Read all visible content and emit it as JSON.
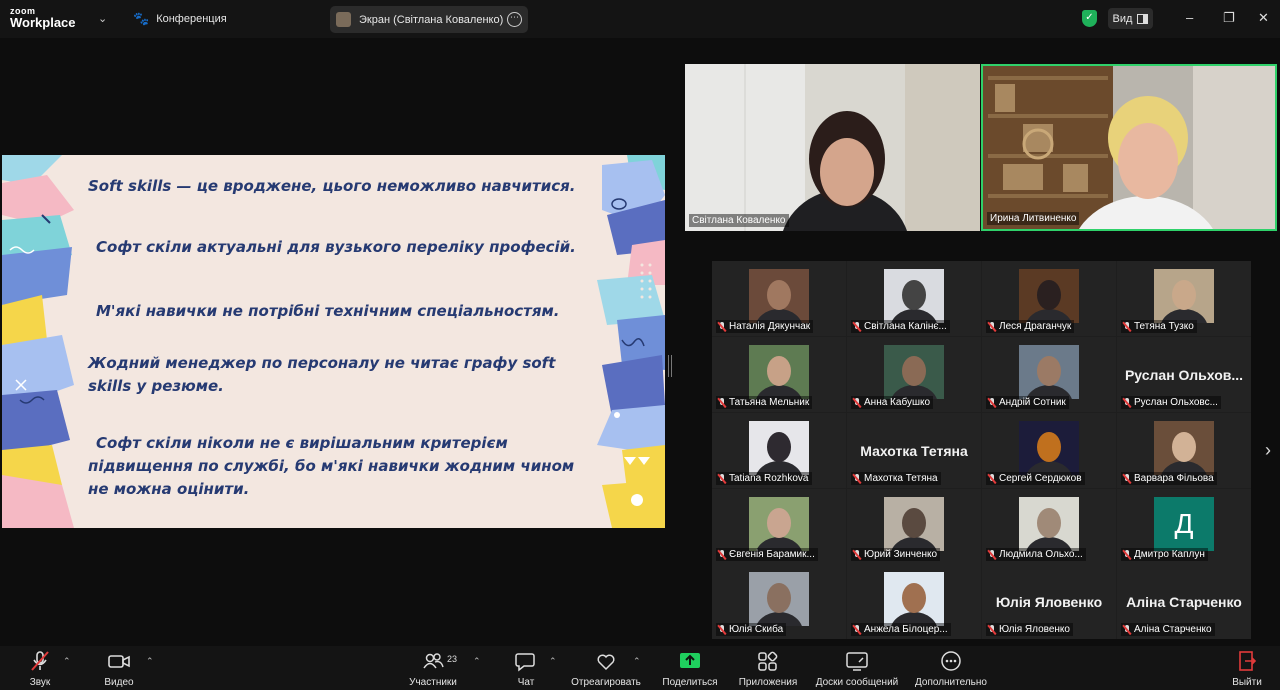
{
  "topbar": {
    "logo_line1": "zoom",
    "logo_line2": "Workplace",
    "meeting": "Конференция",
    "screen_share": "Экран (Світлана Коваленко)",
    "view_label": "Вид",
    "more_glyph": "⋯",
    "minimize": "–",
    "maximize": "❐",
    "close": "✕"
  },
  "slide": {
    "lines": [
      "Soft skills — це вроджене, цього неможливо навчитися.",
      "Софт скіли актуальні для вузького переліку професій.",
      "М'які навички не потрібні технічним  спеціальностям.",
      "Жодний менеджер по персоналу не читає графу soft",
      "skills у резюме.",
      "Софт  скіли  ніколи  не  є  вирішальним  критерієм",
      "підвищення по службі, бо м'які навички жодним чином",
      "не можна оцінити."
    ]
  },
  "speakers": [
    {
      "name": "Світлана Коваленко"
    },
    {
      "name": "Ирина Литвиненко"
    }
  ],
  "gallery": [
    {
      "label": "Наталія Дякунчак",
      "bg": "#6b4a3a",
      "face": "#a07860"
    },
    {
      "label": "Світлана Калінє...",
      "bg": "#d9dbe0",
      "face": "#444"
    },
    {
      "label": "Леся Драганчук",
      "bg": "#5b3a24",
      "face": "#2a2020"
    },
    {
      "label": "Тетяна Тузко",
      "bg": "#b7a58a",
      "face": "#c9a88a"
    },
    {
      "label": "Татьяна Мельник",
      "bg": "#5e7b52",
      "face": "#c7a187"
    },
    {
      "label": "Анна Кабушко",
      "bg": "#3a5a4a",
      "face": "#8a6a55"
    },
    {
      "label": "Андрій Сотник",
      "bg": "#6b7a8a",
      "face": "#9b7a65"
    },
    {
      "label": "Руслан Ольховс...",
      "big": "Руслан  Ольхов..."
    },
    {
      "label": "Tatiana Rozhkova",
      "bg": "#e6e6ea",
      "face": "#2e2a30"
    },
    {
      "label": "Махотка Тетяна",
      "big": "Махотка Тетяна"
    },
    {
      "label": "Сергей Сердюков",
      "bg": "#1c1c3a",
      "face": "#c0701e"
    },
    {
      "label": "Варвара Фільова",
      "bg": "#6a4e3a",
      "face": "#d2b296"
    },
    {
      "label": "Євгенія Барамик...",
      "bg": "#8aa070",
      "face": "#c9a590"
    },
    {
      "label": "Юрий Зинченко",
      "bg": "#b8b0a4",
      "face": "#5a4a40"
    },
    {
      "label": "Людмила Ольхо...",
      "bg": "#d8d8d0",
      "face": "#a08a78"
    },
    {
      "label": "Дмитро Каплун",
      "avatar": "Д",
      "avatar_bg": "#0c7a6a"
    },
    {
      "label": "Юлія Скиба",
      "bg": "#9aa0a8",
      "face": "#8a7060"
    },
    {
      "label": "Анжела Білоцер...",
      "bg": "#e0e8f0",
      "face": "#a07050"
    },
    {
      "label": "Юлія Яловенко",
      "big": "Юлія Яловенко"
    },
    {
      "label": "Аліна Старченко",
      "big": "Аліна Старченко"
    }
  ],
  "toolbar": {
    "sound": "Звук",
    "video": "Видео",
    "participants": "Участники",
    "participants_count": "23",
    "chat": "Чат",
    "react": "Отреагировать",
    "share": "Поделиться",
    "apps": "Приложения",
    "boards": "Доски сообщений",
    "more": "Дополнительно",
    "leave": "Выйти"
  }
}
